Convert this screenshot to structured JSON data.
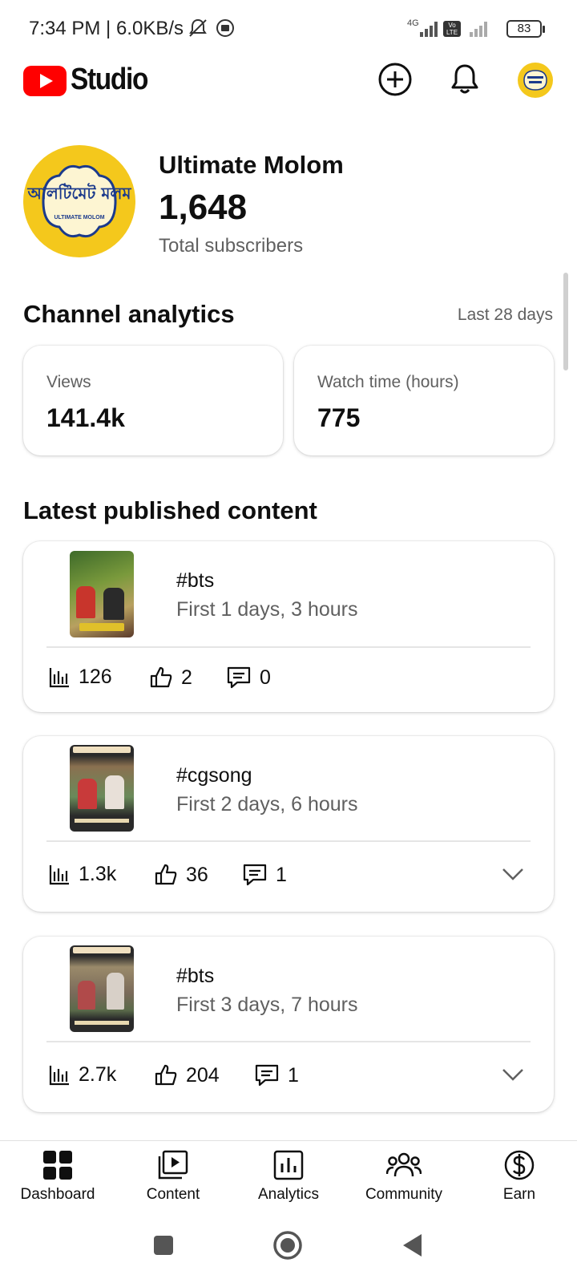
{
  "status_bar": {
    "time": "7:34 PM | 6.0KB/s",
    "network_label": "4G",
    "volte_label": "Vo LTE",
    "battery": "83"
  },
  "header": {
    "app_name": "Studio",
    "create_icon": "plus-circle-icon",
    "notification_icon": "bell-icon",
    "account_icon": "avatar"
  },
  "channel": {
    "name": "Ultimate Molom",
    "subscriber_count": "1,648",
    "subscriber_label": "Total subscribers",
    "logo_text_bn": "আলটিমেট মলম",
    "logo_text_en": "ULTIMATE MOLOM"
  },
  "analytics": {
    "title": "Channel analytics",
    "period": "Last 28 days",
    "metrics": [
      {
        "label": "Views",
        "value": "141.4k"
      },
      {
        "label": "Watch time (hours)",
        "value": "775"
      }
    ]
  },
  "latest": {
    "title": "Latest published content",
    "items": [
      {
        "title": "#bts",
        "subtitle": "First 1 days, 3 hours",
        "views": "126",
        "likes": "2",
        "comments": "0",
        "expandable": false
      },
      {
        "title": "#cgsong",
        "subtitle": "First 2 days, 6 hours",
        "views": "1.3k",
        "likes": "36",
        "comments": "1",
        "expandable": true
      },
      {
        "title": "#bts",
        "subtitle": "First 3 days, 7 hours",
        "views": "2.7k",
        "likes": "204",
        "comments": "1",
        "expandable": true
      }
    ]
  },
  "bottom_nav": [
    {
      "label": "Dashboard",
      "icon": "dashboard-icon",
      "active": true
    },
    {
      "label": "Content",
      "icon": "content-icon",
      "active": false
    },
    {
      "label": "Analytics",
      "icon": "analytics-icon",
      "active": false
    },
    {
      "label": "Community",
      "icon": "community-icon",
      "active": false
    },
    {
      "label": "Earn",
      "icon": "earn-icon",
      "active": false
    }
  ],
  "colors": {
    "brand_red": "#ff0000",
    "avatar_yellow": "#f4c81c",
    "text_secondary": "#606060"
  }
}
